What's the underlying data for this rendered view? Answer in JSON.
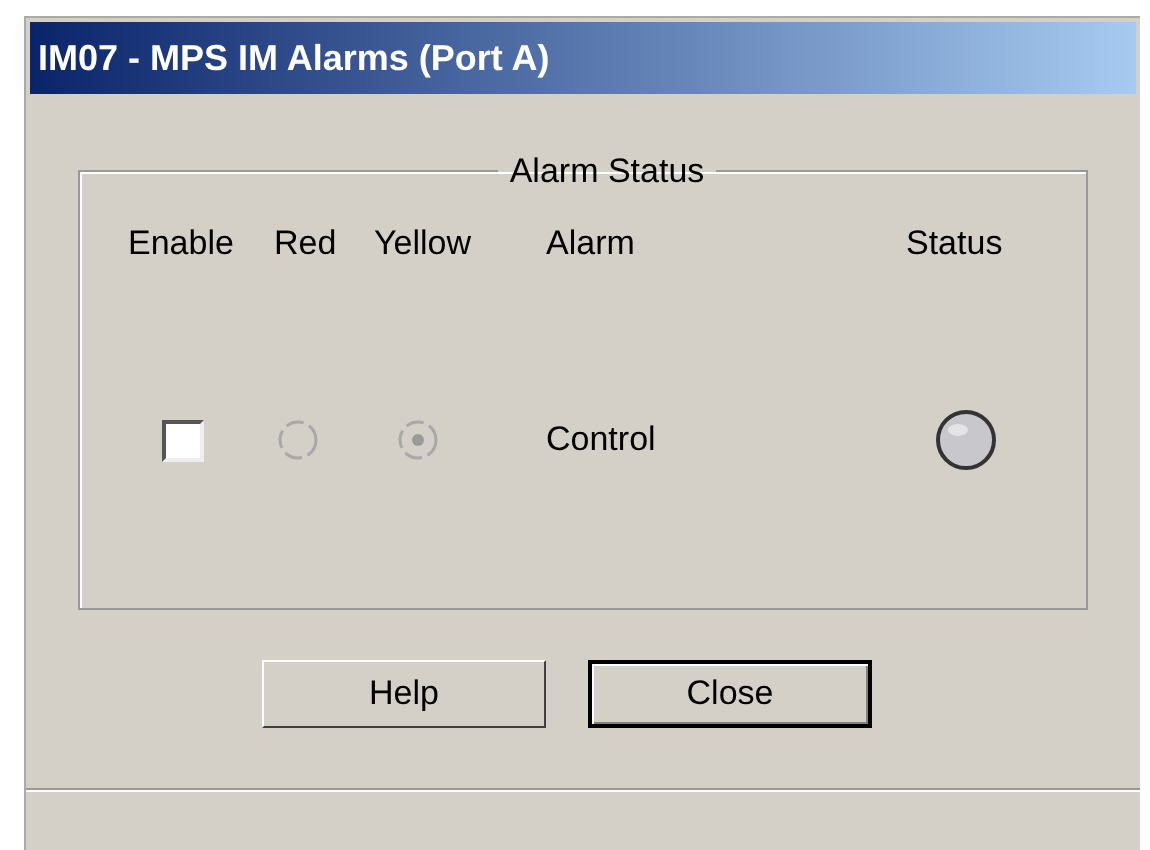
{
  "window": {
    "title": "IM07 - MPS IM Alarms (Port A)"
  },
  "group": {
    "title": "Alarm Status"
  },
  "columns": [
    "Enable",
    "Red",
    "Yellow",
    "Alarm",
    "Status"
  ],
  "rows": [
    {
      "enable": {
        "checked": false
      },
      "red": {
        "selected": false,
        "disabled": true
      },
      "yellow": {
        "selected": true,
        "disabled": true
      },
      "alarm": "Control",
      "status": {
        "on": false
      }
    }
  ],
  "buttons": [
    {
      "label": "Help",
      "default": false
    },
    {
      "label": "Close",
      "default": true
    }
  ]
}
